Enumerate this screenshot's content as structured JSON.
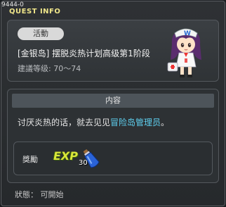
{
  "window": {
    "quest_id": "9444-0",
    "title": "QUEST INFO"
  },
  "quest": {
    "tag": "活動",
    "title": "[金银岛] 摆脱炎热计划高级第1阶段",
    "level": "建議等级: 70～74"
  },
  "content": {
    "header": "内容",
    "text_before": "讨厌炎热的话，就去见见",
    "text_highlight": "冒险岛管理员",
    "text_after": "。"
  },
  "reward": {
    "label": "獎勵",
    "exp_label": "EXP",
    "item_icon": "blue-potion-icon",
    "item_qty": "30"
  },
  "status": {
    "text": "狀態： 可開始"
  },
  "colors": {
    "title": "#f0e68a",
    "highlight": "#5ed0f0",
    "exp": "#d9e63a"
  }
}
